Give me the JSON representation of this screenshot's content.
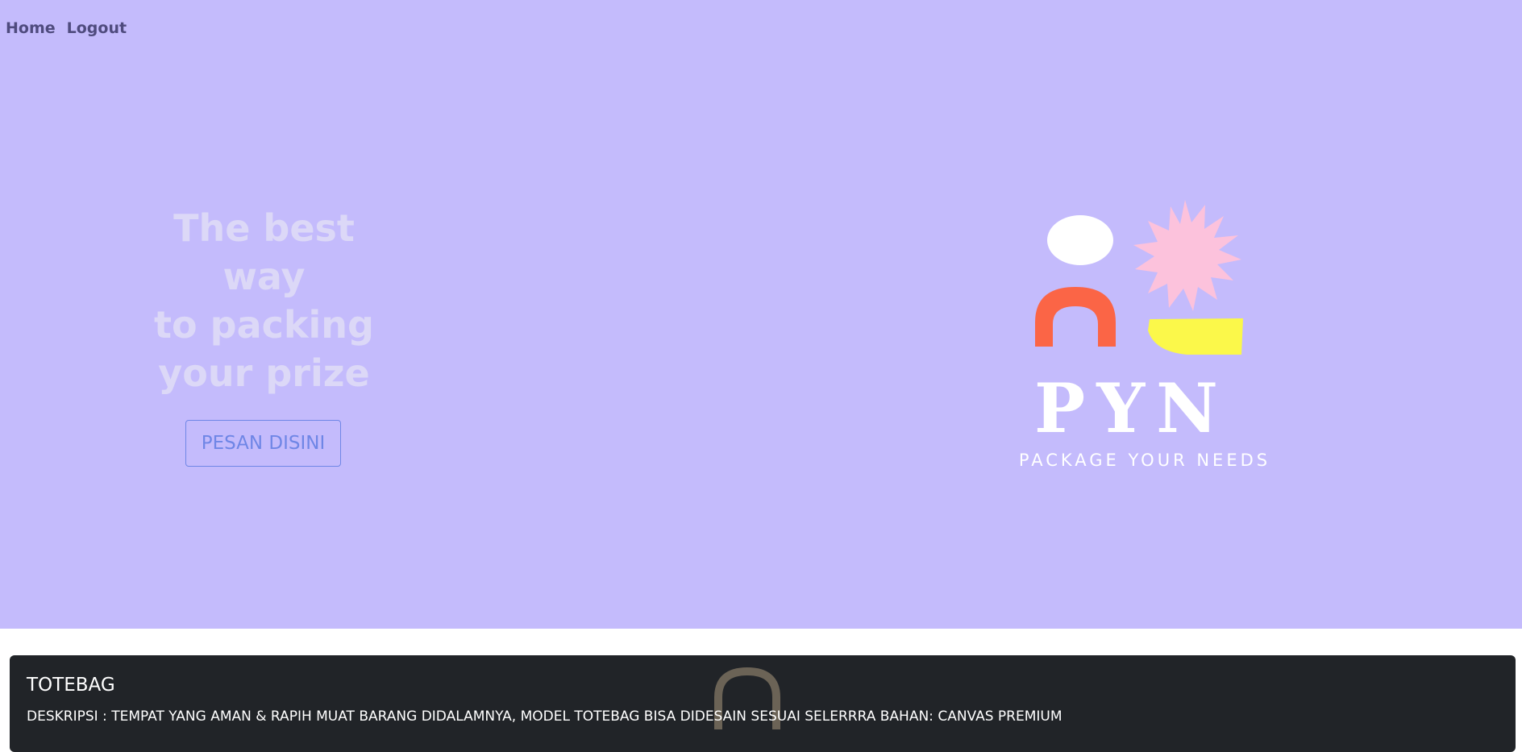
{
  "nav": {
    "items": [
      {
        "label": "Home"
      },
      {
        "label": "Logout"
      }
    ]
  },
  "hero": {
    "headline_lines": [
      "The best",
      "way",
      "to packing",
      "your prize"
    ],
    "cta_label": "PESAN DISINI",
    "background": "#c4bbfc",
    "logo": {
      "brand": "PYN",
      "tagline": "PACKAGE YOUR NEEDS",
      "colors": {
        "circle": "#ffffff",
        "star": "#fcc2dc",
        "arch": "#fb6546",
        "wedge": "#fbf84a",
        "text": "#ffffff"
      }
    }
  },
  "product": {
    "title": "TOTEBAG",
    "description": "DESKRIPSI : TEMPAT YANG AMAN & RAPIH MUAT BARANG DIDALAMNYA, MODEL TOTEBAG BISA DIDESAIN SESUAI SELERRRA BAHAN: CANVAS PREMIUM"
  }
}
